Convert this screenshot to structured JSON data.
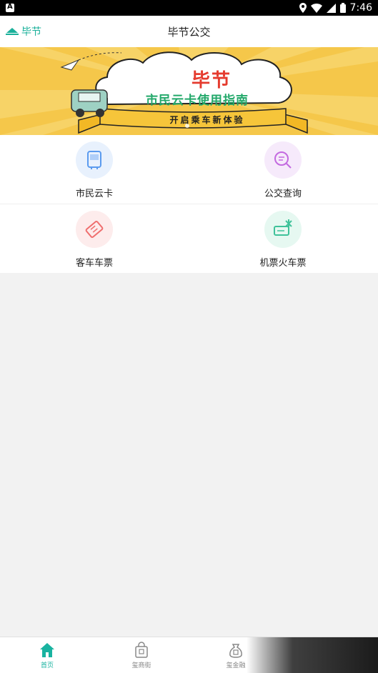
{
  "status_bar": {
    "time": "7:46"
  },
  "header": {
    "city": "毕节",
    "title": "毕节公交"
  },
  "banner": {
    "title": "毕节",
    "subtitle": "市民云卡使用指南",
    "ribbon": "开启乘车新体验"
  },
  "services": [
    {
      "label": "市民云卡",
      "icon": "bus-card-icon",
      "bg": "#e8f1fd",
      "color": "#5b9bef"
    },
    {
      "label": "公交查询",
      "icon": "bus-search-icon",
      "bg": "#f6eafb",
      "color": "#c36ae0"
    },
    {
      "label": "客车车票",
      "icon": "ticket-icon",
      "bg": "#fdecec",
      "color": "#ef6e6e"
    },
    {
      "label": "机票火车票",
      "icon": "plane-ticket-icon",
      "bg": "#e6f8f1",
      "color": "#3fc29a"
    }
  ],
  "bottom_nav": [
    {
      "label": "首页",
      "icon": "home-icon",
      "active": true
    },
    {
      "label": "玺商街",
      "icon": "shop-bag-icon",
      "active": false
    },
    {
      "label": "玺金融",
      "icon": "money-bag-icon",
      "active": false
    }
  ],
  "colors": {
    "accent": "#19b3a0",
    "banner_bg": "#f5c74a"
  }
}
